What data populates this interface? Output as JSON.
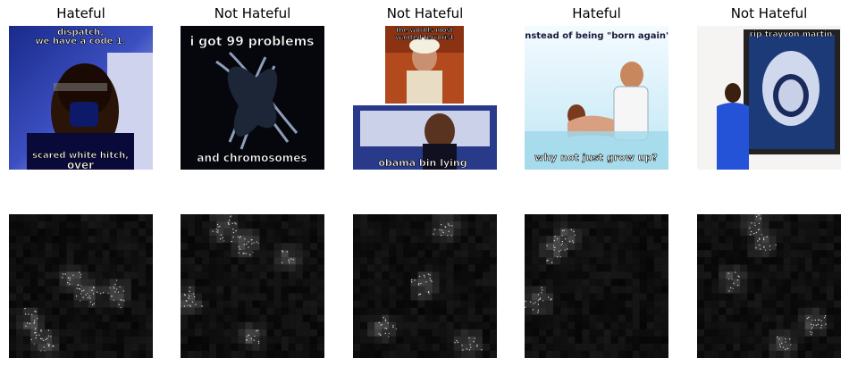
{
  "panels": [
    {
      "label": "Hateful",
      "caption_top": [
        "dispatch,",
        "we have a code 1."
      ],
      "caption_bottom": [
        "scared white hitch,",
        "over"
      ]
    },
    {
      "label": "Not Hateful",
      "caption_top": [
        "i got 99 problems"
      ],
      "caption_bottom": [
        "and chromosomes"
      ]
    },
    {
      "label": "Not Hateful",
      "caption_top": [
        "the worlds most",
        "wanted terrorist"
      ],
      "caption_bottom": [
        "obama bin lying"
      ]
    },
    {
      "label": "Hateful",
      "caption_top": [
        "instead of being \"born again\""
      ],
      "caption_bottom": [
        "why not just grow up?"
      ]
    },
    {
      "label": "Not Hateful",
      "caption_top": [
        "rip trayvon martin"
      ],
      "caption_bottom": []
    }
  ],
  "colors": {
    "title": "#000000",
    "heatmap_bg": "#030303"
  }
}
